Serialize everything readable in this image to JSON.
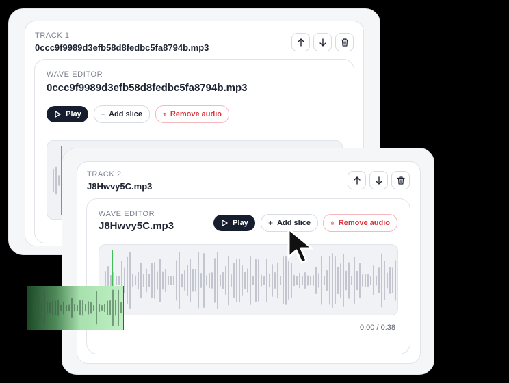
{
  "track1": {
    "label": "TRACK 1",
    "filename": "0ccc9f9989d3efb58d8fedbc5fa8794b.mp3",
    "wave_editor": {
      "label": "WAVE EDITOR",
      "filename": "0ccc9f9989d3efb58d8fedbc5fa8794b.mp3",
      "play_label": "Play",
      "add_slice_label": "Add slice",
      "remove_audio_label": "Remove audio"
    }
  },
  "track2": {
    "label": "TRACK 2",
    "filename": "J8Hwvy5C.mp3",
    "wave_editor": {
      "label": "WAVE EDITOR",
      "filename": "J8Hwvy5C.mp3",
      "play_label": "Play",
      "add_slice_label": "Add slice",
      "remove_audio_label": "Remove audio",
      "time": "0:00 / 0:38"
    }
  },
  "colors": {
    "play_button": "#161d2e",
    "remove_audio": "#d9323a",
    "playhead": "#3fbf55",
    "waveform": "#c3c6cf"
  },
  "icons": {
    "move_up": "arrow-up-icon",
    "move_down": "arrow-down-icon",
    "delete": "trash-icon",
    "play": "play-icon",
    "add": "plus-icon",
    "remove": "trash-icon",
    "pointer": "cursor-arrow-icon"
  }
}
